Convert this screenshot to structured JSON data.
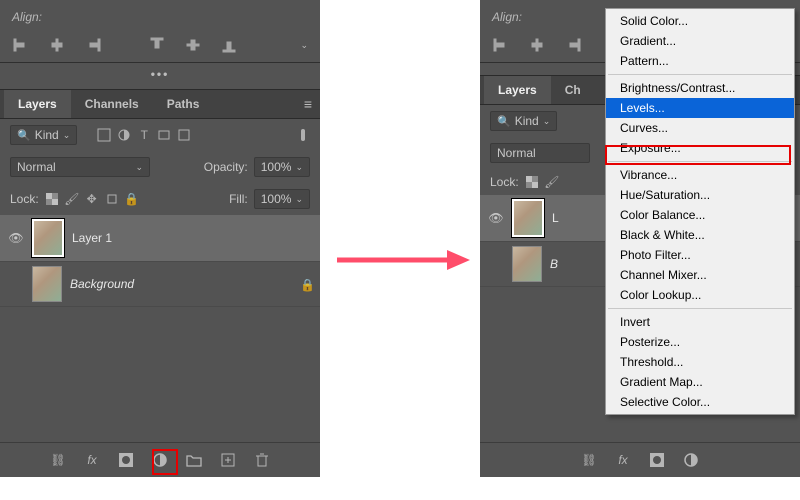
{
  "align_label": "Align:",
  "tabs": {
    "layers": "Layers",
    "channels": "Channels",
    "paths": "Paths"
  },
  "filter": {
    "label": "Kind"
  },
  "blend": {
    "mode": "Normal",
    "opacity_label": "Opacity:",
    "opacity": "100%"
  },
  "lock": {
    "label": "Lock:",
    "fill_label": "Fill:",
    "fill": "100%"
  },
  "layers": [
    {
      "name": "Layer 1",
      "visible": true,
      "selected": true
    },
    {
      "name": "Background",
      "visible": true,
      "locked": true,
      "italic": true
    }
  ],
  "menu": {
    "g1": [
      "Solid Color...",
      "Gradient...",
      "Pattern..."
    ],
    "g2": [
      "Brightness/Contrast...",
      "Levels...",
      "Curves...",
      "Exposure..."
    ],
    "g3": [
      "Vibrance...",
      "Hue/Saturation...",
      "Color Balance...",
      "Black & White...",
      "Photo Filter...",
      "Channel Mixer...",
      "Color Lookup..."
    ],
    "g4": [
      "Invert",
      "Posterize...",
      "Threshold...",
      "Gradient Map...",
      "Selective Color..."
    ],
    "highlight": "Levels..."
  }
}
